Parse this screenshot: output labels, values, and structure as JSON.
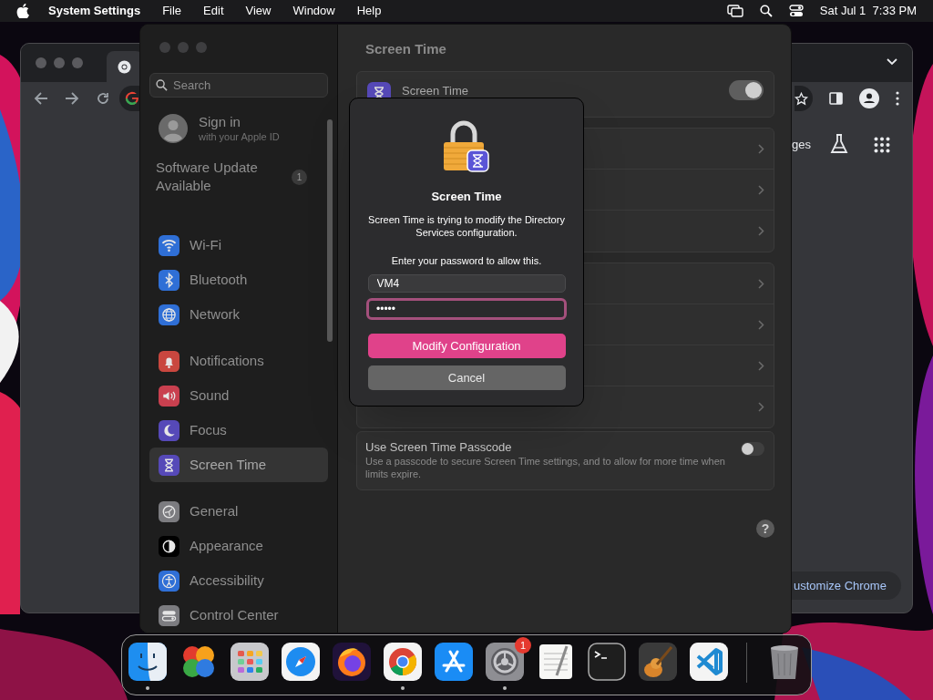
{
  "menu_bar": {
    "app": "System Settings",
    "menus": [
      "File",
      "Edit",
      "View",
      "Window",
      "Help"
    ],
    "clock": "Sat Jul 1  7:33 PM"
  },
  "browser": {
    "link_fragment": "ges",
    "customize_button": "ustomize Chrome"
  },
  "settings": {
    "sidebar": {
      "search": {
        "placeholder": "Search"
      },
      "account": {
        "title": "Sign in",
        "subtitle": "with your Apple ID"
      },
      "update": {
        "label": "Software Update Available",
        "badge": "1"
      },
      "groups": [
        [
          {
            "kind": "wifi",
            "label": "Wi-Fi",
            "color": "#2f6fd6",
            "selected": false
          },
          {
            "kind": "bluetooth",
            "label": "Bluetooth",
            "color": "#2f6fd6",
            "selected": false
          },
          {
            "kind": "network",
            "label": "Network",
            "color": "#2f6fd6",
            "selected": false
          }
        ],
        [
          {
            "kind": "notifications",
            "label": "Notifications",
            "color": "#c9473f",
            "selected": false
          },
          {
            "kind": "sound",
            "label": "Sound",
            "color": "#c9404f",
            "selected": false
          },
          {
            "kind": "focus",
            "label": "Focus",
            "color": "#5649b8",
            "selected": false
          },
          {
            "kind": "screentime",
            "label": "Screen Time",
            "color": "#5649b8",
            "selected": true
          }
        ],
        [
          {
            "kind": "general",
            "label": "General",
            "color": "#7c7c80",
            "selected": false
          },
          {
            "kind": "appearance",
            "label": "Appearance",
            "color": "#000000",
            "selected": false
          },
          {
            "kind": "accessibility",
            "label": "Accessibility",
            "color": "#2f6fd6",
            "selected": false
          },
          {
            "kind": "controlcenter",
            "label": "Control Center",
            "color": "#7c7c80",
            "selected": false
          }
        ]
      ]
    },
    "content": {
      "title": "Screen Time",
      "main_toggle": {
        "label": "Screen Time",
        "on": true
      },
      "link_groups": [
        [
          {
            "kind": "link"
          },
          {
            "kind": "link"
          },
          {
            "kind": "link"
          }
        ],
        [
          {
            "kind": "link"
          },
          {
            "kind": "link"
          },
          {
            "kind": "link"
          },
          {
            "kind": "link"
          }
        ]
      ],
      "passcode": {
        "title": "Use Screen Time Passcode",
        "description": "Use a passcode to secure Screen Time settings, and to allow for more time when limits expire.",
        "on": false
      },
      "help": "?"
    }
  },
  "dialog": {
    "title": "Screen Time",
    "message": "Screen Time is trying to modify the Directory Services configuration.",
    "prompt": "Enter your password to allow this.",
    "username": "VM4",
    "password": "•••••",
    "buttons": [
      {
        "kind": "primary",
        "label": "Modify Configuration"
      },
      {
        "kind": "secondary",
        "label": "Cancel"
      }
    ]
  },
  "dock": [
    {
      "kind": "finder",
      "running": true
    },
    {
      "kind": "clover",
      "running": false
    },
    {
      "kind": "launchpad",
      "running": false
    },
    {
      "kind": "safari",
      "running": false
    },
    {
      "kind": "firefox",
      "running": false
    },
    {
      "kind": "chrome",
      "running": true
    },
    {
      "kind": "appstore",
      "running": false
    },
    {
      "kind": "settings",
      "running": true,
      "badge": "1"
    },
    {
      "kind": "textedit",
      "running": false
    },
    {
      "kind": "terminal",
      "running": false
    },
    {
      "kind": "guitar",
      "running": false
    },
    {
      "kind": "vscode",
      "running": false
    },
    {
      "kind": "trash",
      "running": false
    }
  ]
}
